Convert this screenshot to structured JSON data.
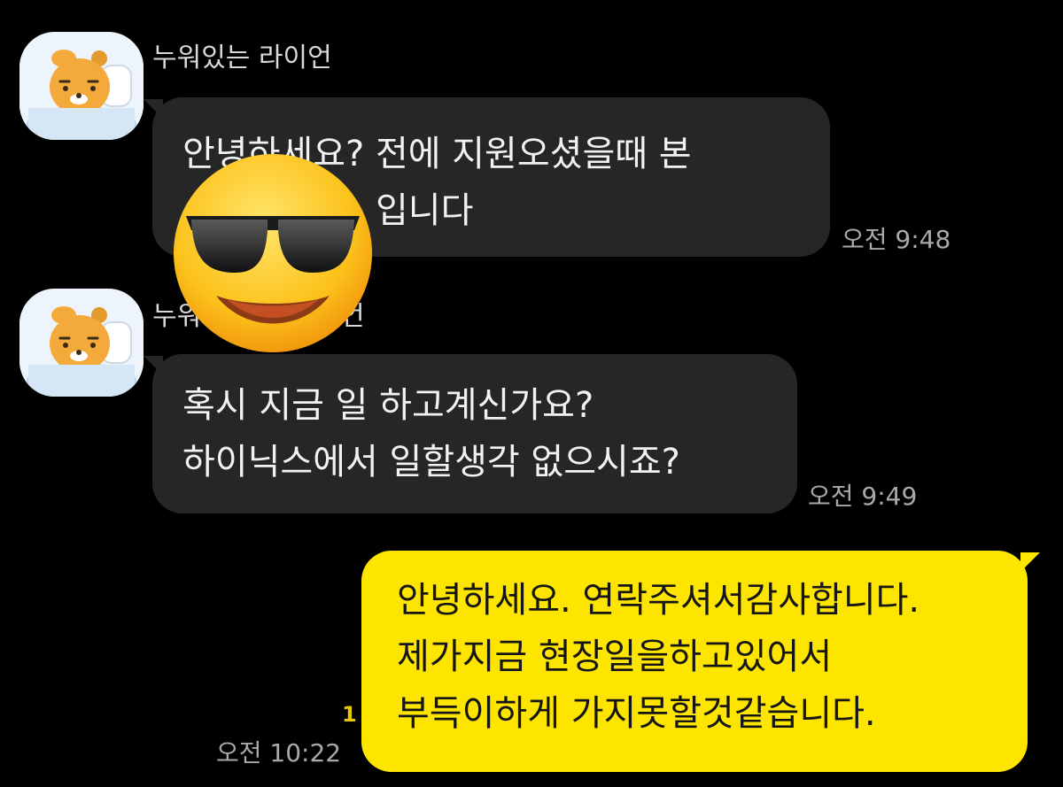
{
  "colors": {
    "background": "#000000",
    "incoming_bubble": "#262626",
    "outgoing_bubble": "#fee500",
    "unread_count": "#e6c700"
  },
  "messages": [
    {
      "sender": "누워있는 라이언",
      "lines": [
        "안녕하세요?  전에 지원오셨을때 본",
        "입니다"
      ],
      "time": "오전 9:48"
    },
    {
      "sender": "누워",
      "sender_tail": "언",
      "lines": [
        "혹시 지금 일 하고계신가요?",
        "하이닉스에서 일할생각 없으시죠?"
      ],
      "time": "오전 9:49"
    },
    {
      "lines": [
        "안녕하세요. 연락주셔서감사합니다.",
        "제가지금 현장일을하고있어서",
        "부득이하게 가지못할것같습니다."
      ],
      "time": "오전 10:22",
      "unread": "1"
    }
  ],
  "icons": {
    "avatar": "ryan-lying-in-bed-avatar",
    "overlay": "smiling-face-with-sunglasses-emoji"
  }
}
